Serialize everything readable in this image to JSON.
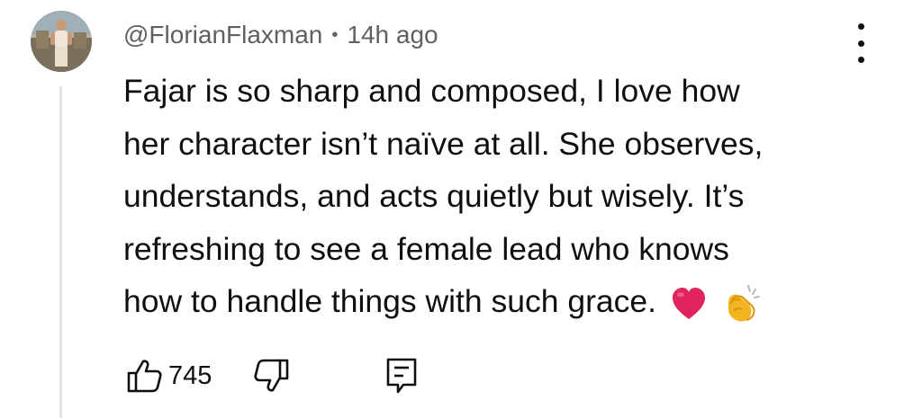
{
  "comment": {
    "author": "@FlorianFlaxman",
    "separator": "•",
    "timestamp": "14h ago",
    "text_lines": [
      "Fajar is so sharp and composed, I love how",
      "her character isn’t naïve at all. She observes,",
      "understands, and acts quietly but wisely. It’s",
      "refreshing to see a female lead who knows",
      "how to handle things with such grace."
    ],
    "emojis": [
      "red-heart",
      "clapping-hands"
    ],
    "like_count": "745"
  },
  "icons": {
    "more": "more-vertical-icon",
    "like": "thumbs-up-icon",
    "dislike": "thumbs-down-icon",
    "reply": "reply-comment-icon"
  },
  "colors": {
    "text": "#0f0f0f",
    "meta": "#606060",
    "thread_line": "#e2e2e2",
    "heart": "#e0245e",
    "clap": "#f7c23a"
  }
}
